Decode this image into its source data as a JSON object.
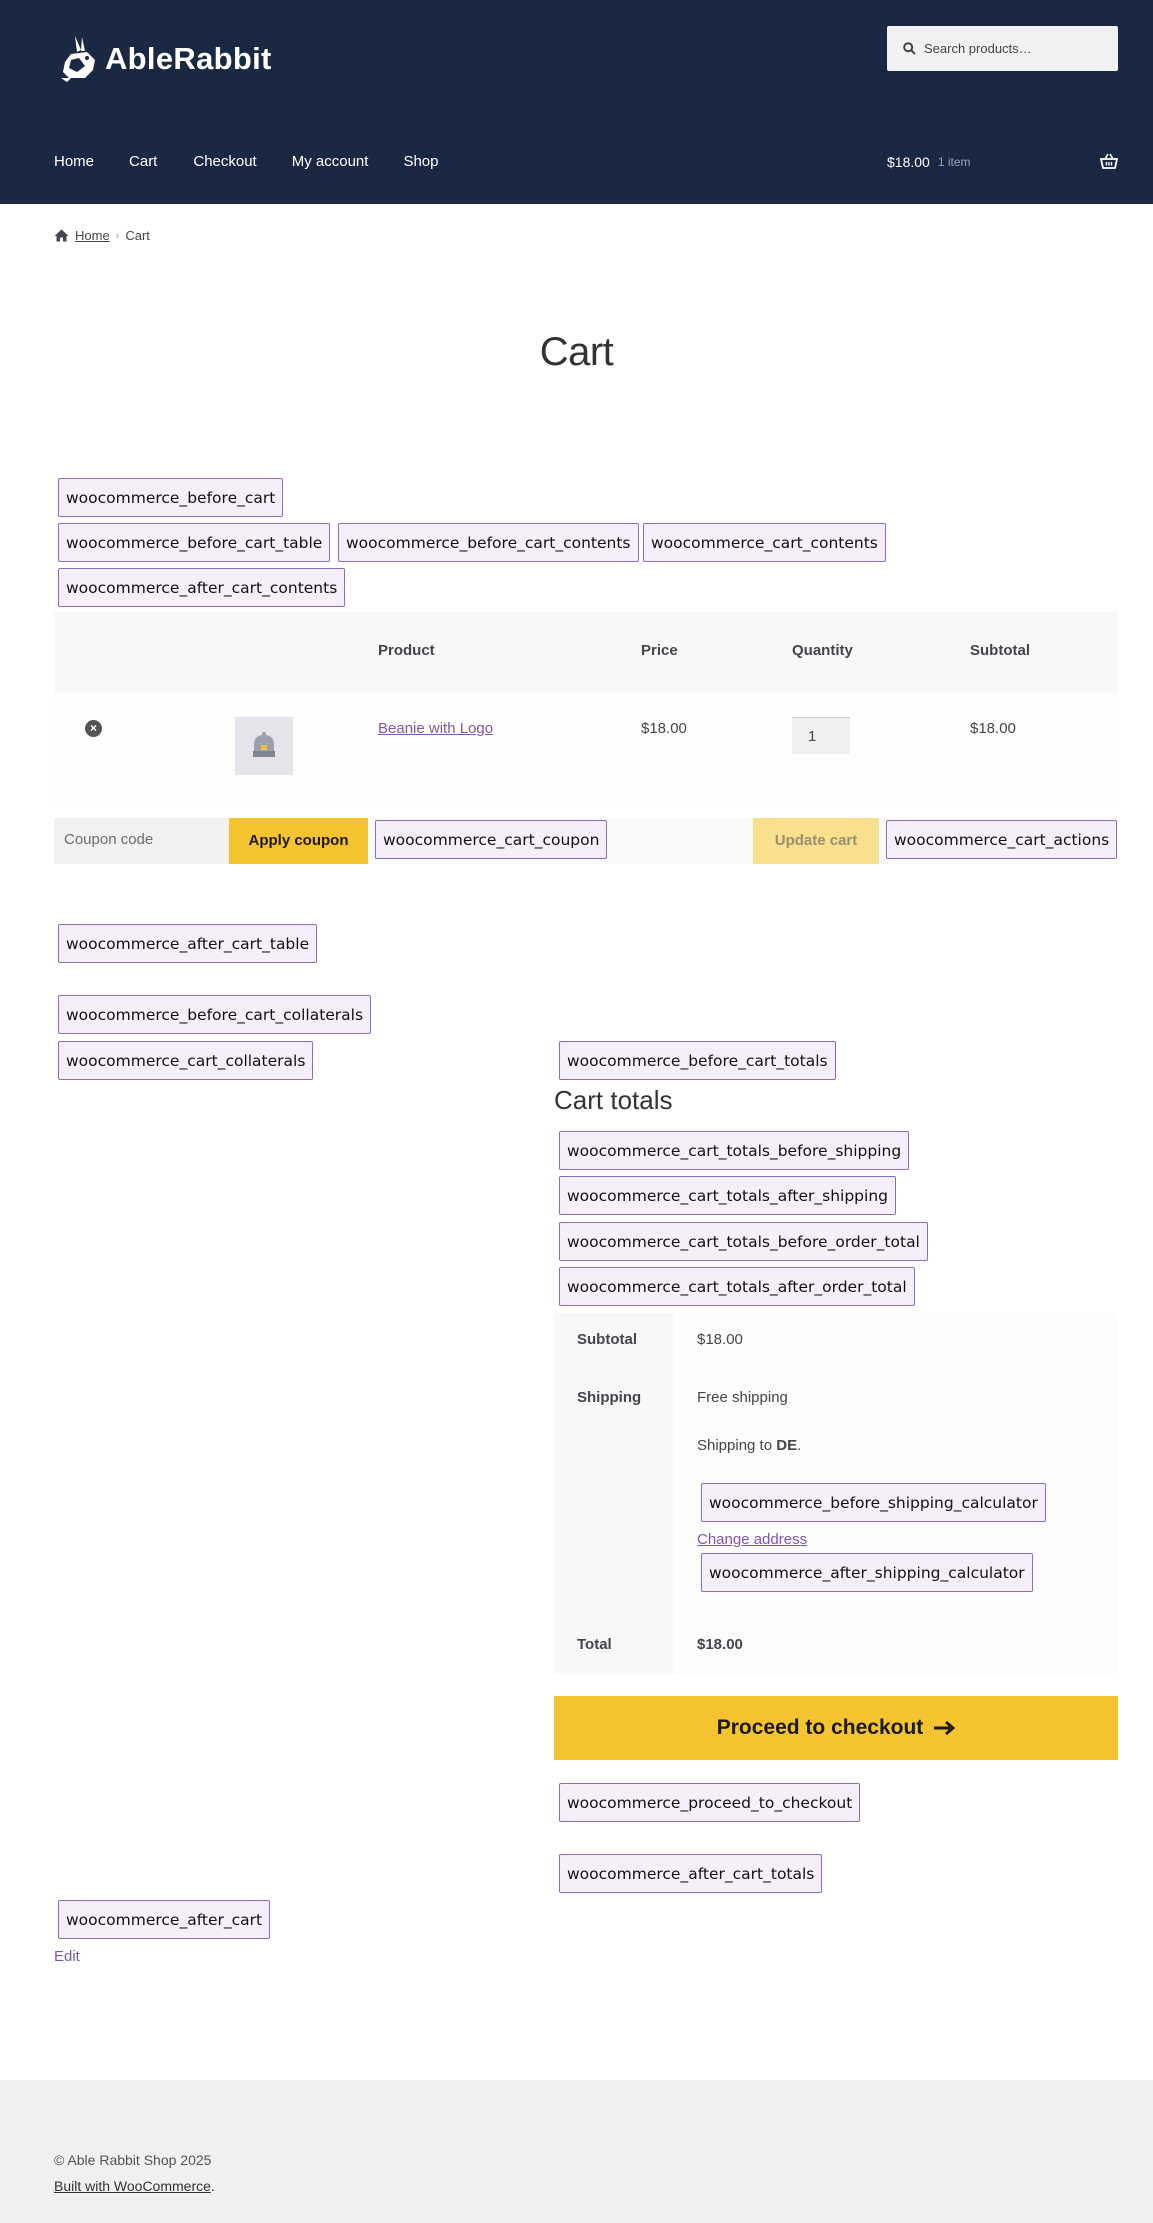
{
  "header": {
    "logo_text": "AbleRabbit",
    "search_placeholder": "Search products…",
    "nav": [
      "Home",
      "Cart",
      "Checkout",
      "My account",
      "Shop"
    ],
    "mini_cart": {
      "amount": "$18.00",
      "count": "1 item"
    }
  },
  "breadcrumb": {
    "home": "Home",
    "current": "Cart"
  },
  "page_title": "Cart",
  "hooks": {
    "before_cart": "woocommerce_before_cart",
    "before_cart_table": "woocommerce_before_cart_table",
    "before_cart_contents": "woocommerce_before_cart_contents",
    "cart_contents": "woocommerce_cart_contents",
    "after_cart_contents": "woocommerce_after_cart_contents",
    "cart_coupon": "woocommerce_cart_coupon",
    "cart_actions": "woocommerce_cart_actions",
    "after_cart_table": "woocommerce_after_cart_table",
    "before_cart_collaterals": "woocommerce_before_cart_collaterals",
    "cart_collaterals": "woocommerce_cart_collaterals",
    "before_cart_totals": "woocommerce_before_cart_totals",
    "totals_before_shipping": "woocommerce_cart_totals_before_shipping",
    "totals_after_shipping": "woocommerce_cart_totals_after_shipping",
    "totals_before_order_total": "woocommerce_cart_totals_before_order_total",
    "totals_after_order_total": "woocommerce_cart_totals_after_order_total",
    "before_shipping_calculator": "woocommerce_before_shipping_calculator",
    "after_shipping_calculator": "woocommerce_after_shipping_calculator",
    "proceed_to_checkout": "woocommerce_proceed_to_checkout",
    "after_cart_totals": "woocommerce_after_cart_totals",
    "after_cart": "woocommerce_after_cart"
  },
  "table": {
    "headers": {
      "product": "Product",
      "price": "Price",
      "quantity": "Quantity",
      "subtotal": "Subtotal"
    },
    "rows": [
      {
        "remove": "×",
        "product": "Beanie with Logo",
        "price": "$18.00",
        "quantity": "1",
        "subtotal": "$18.00"
      }
    ]
  },
  "actions": {
    "coupon_placeholder": "Coupon code",
    "apply_coupon": "Apply coupon",
    "update_cart": "Update cart"
  },
  "totals": {
    "title": "Cart totals",
    "subtotal_label": "Subtotal",
    "subtotal_value": "$18.00",
    "shipping_label": "Shipping",
    "shipping_method": "Free shipping",
    "shipping_to_prefix": "Shipping to",
    "shipping_to_country": "DE",
    "shipping_to_suffix": ".",
    "change_address": "Change address",
    "total_label": "Total",
    "total_value": "$18.00",
    "checkout_button": "Proceed to checkout"
  },
  "edit_link": "Edit",
  "footer": {
    "copyright": "© Able Rabbit Shop 2025",
    "built_link": "Built with WooCommerce",
    "built_suffix": "."
  },
  "colors": {
    "header_bg": "#1b2844",
    "accent_yellow": "#f5c330",
    "link_purple": "#7f54b3",
    "hook_border": "#8b6bbf"
  }
}
